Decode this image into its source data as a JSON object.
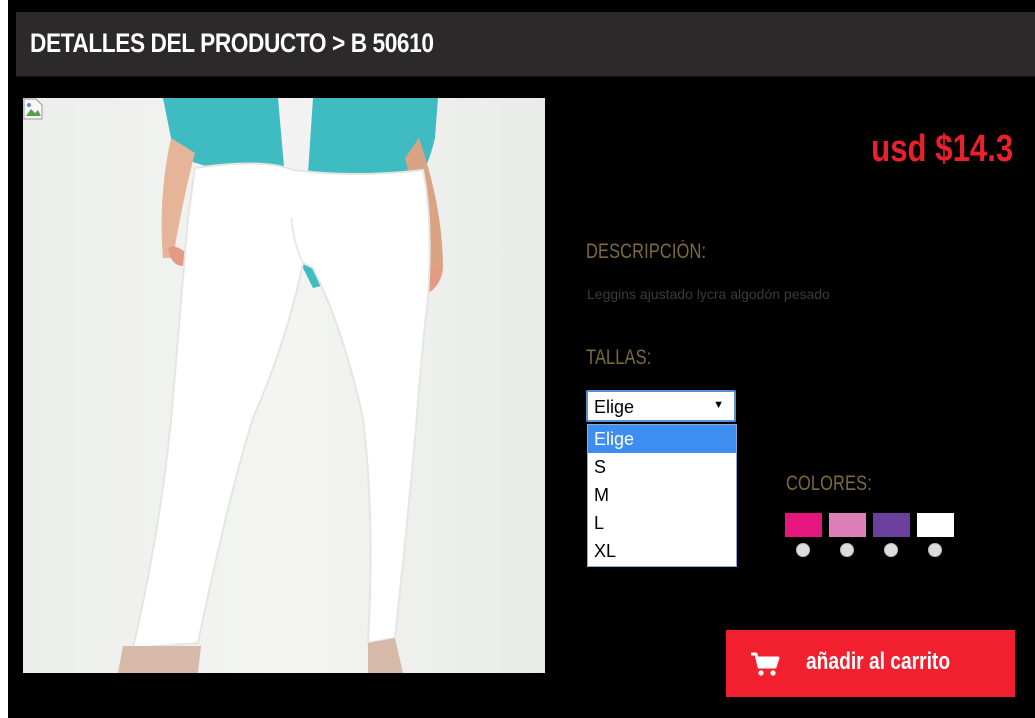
{
  "header": {
    "title": "DETALLES DEL PRODUCTO > B 50610"
  },
  "product": {
    "price": "usd $14.3",
    "description_label": "DESCRIPCIÓN:",
    "description": "Leggins ajustado lycra algodón pesado",
    "sizes_label": "TALLAS:",
    "colors_label": "COLORES:"
  },
  "size_select": {
    "value": "Elige",
    "options": [
      "Elige",
      "S",
      "M",
      "L",
      "XL"
    ]
  },
  "colors": [
    {
      "hex": "#e5177f"
    },
    {
      "hex": "#de80b7"
    },
    {
      "hex": "#6b3f9c"
    },
    {
      "hex": "#ffffff"
    }
  ],
  "cart": {
    "label": "añadir al carrito",
    "icon": "shopping-cart-icon"
  },
  "theme": {
    "header_bg": "#2b2929",
    "page_bg": "#000000",
    "accent_red": "#f2202e",
    "price_red": "#e8212c",
    "label_gold": "#7d6b3e",
    "selected_blue": "#3d8ef0"
  }
}
